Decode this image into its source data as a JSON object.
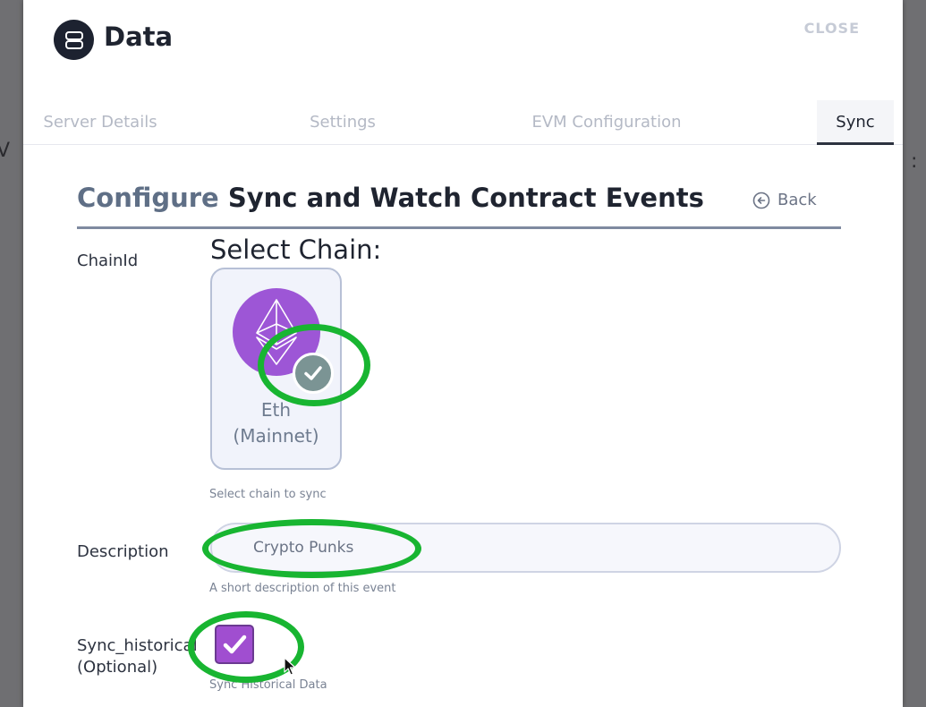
{
  "app": {
    "title": "Data",
    "close_label": "CLOSE"
  },
  "tabs": [
    {
      "label": "Server Details",
      "active": false
    },
    {
      "label": "Settings",
      "active": false
    },
    {
      "label": "EVM Configuration",
      "active": false
    },
    {
      "label": "Sync",
      "active": true
    }
  ],
  "section": {
    "title_prefix": "Configure",
    "title_rest": "Sync and Watch Contract Events",
    "back_label": "Back"
  },
  "form": {
    "chainid": {
      "label": "ChainId",
      "heading": "Select Chain:",
      "card_name": "Eth\n(Mainnet)",
      "selected": true,
      "helper": "Select chain to sync"
    },
    "description": {
      "label": "Description",
      "value": "Crypto Punks",
      "helper": "A short description of this event"
    },
    "sync_historical": {
      "label_line1": "Sync_historical",
      "label_line2": "(Optional)",
      "checked": true,
      "helper": "Sync Historical Data"
    }
  },
  "colors": {
    "accent_purple": "#9d56d6",
    "annotation_green": "#18b531",
    "dark_text": "#1f2430"
  }
}
